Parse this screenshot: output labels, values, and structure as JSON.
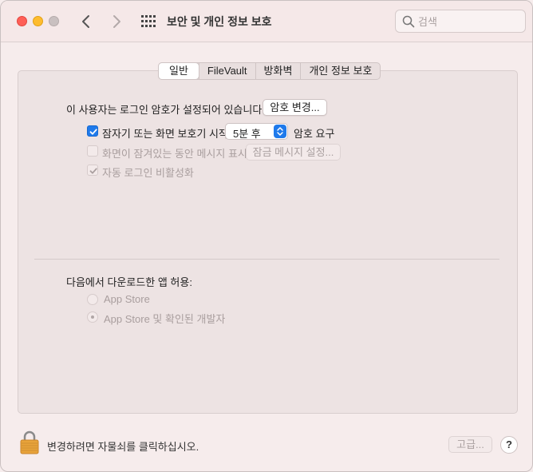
{
  "window": {
    "title": "보안 및 개인 정보 보호"
  },
  "search": {
    "placeholder": "검색"
  },
  "tabs": [
    {
      "label": "일반",
      "active": true
    },
    {
      "label": "FileVault",
      "active": false
    },
    {
      "label": "방화벽",
      "active": false
    },
    {
      "label": "개인 정보 보호",
      "active": false
    }
  ],
  "general": {
    "password_set_text": "이 사용자는 로그인 암호가 설정되어 있습니다.",
    "change_password_label": "암호 변경...",
    "require_password": {
      "label": "잠자기 또는 화면 보호기 시작",
      "checked": true,
      "delay_value": "5분 후",
      "suffix": "암호 요구"
    },
    "show_message": {
      "label": "화면이 잠겨있는 동안 메시지 표시",
      "checked": false,
      "button_label": "잠금 메시지 설정..."
    },
    "disable_auto_login": {
      "label": "자동 로그인 비활성화",
      "checked": true
    }
  },
  "downloads": {
    "heading": "다음에서 다운로드한 앱 허용:",
    "options": [
      {
        "label": "App Store",
        "selected": false
      },
      {
        "label": "App Store 및 확인된 개발자",
        "selected": true
      }
    ]
  },
  "footer": {
    "lock_text": "변경하려면 자물쇠를 클릭하십시오.",
    "advanced_label": "고급...",
    "help_label": "?"
  },
  "colors": {
    "accent": "#1f7aeb",
    "close": "#ff5f57",
    "minimize": "#febc2e",
    "lock": "#e8a33a"
  },
  "icons": [
    "chevron-left-icon",
    "chevron-right-icon",
    "grid-icon",
    "search-icon",
    "checkmark-icon",
    "lock-icon"
  ]
}
